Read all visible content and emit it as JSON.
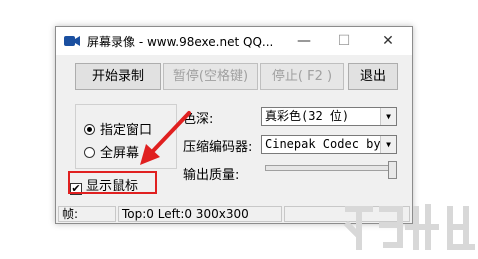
{
  "window": {
    "title": "屏幕录像 - www.98exe.net QQ...",
    "minimize_glyph": "—",
    "maximize_glyph": "☐",
    "close_glyph": "✕"
  },
  "toolbar": {
    "start_label": "开始录制",
    "pause_label": "暂停(空格键)",
    "stop_label": "停止( F2 )",
    "exit_label": "退出"
  },
  "capture_area": {
    "options": [
      {
        "label": "指定窗口",
        "selected": true
      },
      {
        "label": "全屏幕",
        "selected": false
      }
    ]
  },
  "settings": {
    "color_depth_label": "色深:",
    "color_depth_value": "真彩色(32 位)",
    "codec_label": "压缩编码器:",
    "codec_value": "Cinepak Codec by",
    "quality_label": "输出质量:",
    "quality_level": 1.0
  },
  "show_mouse": {
    "label": "显示鼠标",
    "checked": true,
    "check_glyph": "✔"
  },
  "statusbar": {
    "frames_label": "帧:",
    "geometry": "Top:0 Left:0 300x300"
  },
  "icons": {
    "app": "camera-icon",
    "arrow": "red-arrow"
  },
  "colors": {
    "highlight": "#e02020",
    "app_icon": "#1a4fa0"
  }
}
